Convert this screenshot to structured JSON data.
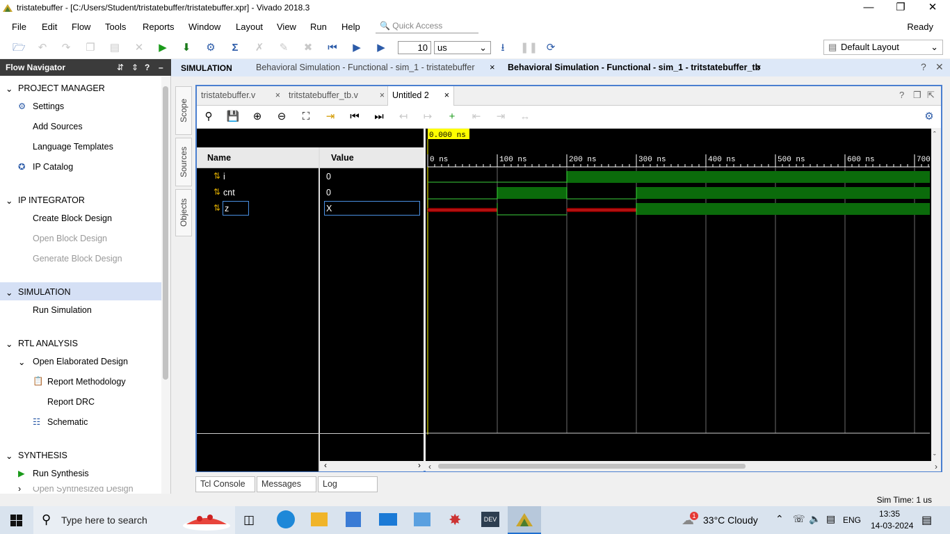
{
  "window": {
    "title": "tristatebuffer - [C:/Users/Student/tristatebuffer/tristatebuffer.xpr] - Vivado 2018.3"
  },
  "menu": [
    "File",
    "Edit",
    "Flow",
    "Tools",
    "Reports",
    "Window",
    "Layout",
    "View",
    "Run",
    "Help"
  ],
  "quick_access": "Quick Access",
  "status": "Ready",
  "toolbar": {
    "time_value": "10",
    "time_unit": "us",
    "layout": "Default Layout"
  },
  "flow_nav": {
    "title": "Flow Navigator",
    "project_manager": "PROJECT MANAGER",
    "settings": "Settings",
    "add_sources": "Add Sources",
    "language_templates": "Language Templates",
    "ip_catalog": "IP Catalog",
    "ip_integrator": "IP INTEGRATOR",
    "create_block": "Create Block Design",
    "open_block": "Open Block Design",
    "generate_block": "Generate Block Design",
    "simulation": "SIMULATION",
    "run_sim": "Run Simulation",
    "rtl": "RTL ANALYSIS",
    "open_elab": "Open Elaborated Design",
    "report_meth": "Report Methodology",
    "report_drc": "Report DRC",
    "schematic": "Schematic",
    "synthesis": "SYNTHESIS",
    "run_synth": "Run Synthesis",
    "open_synth": "Open Synthesized Design"
  },
  "sim_header": {
    "label": "SIMULATION",
    "tab1": "Behavioral Simulation - Functional - sim_1 - tristatebuffer",
    "tab2": "Behavioral Simulation - Functional - sim_1 - tritstatebuffer_tb"
  },
  "side_tabs": [
    "Scope",
    "Sources",
    "Objects"
  ],
  "wave_tabs": [
    "tristatebuffer.v",
    "tritstatebuffer_tb.v",
    "Untitled 2"
  ],
  "wave": {
    "cursor": "0.000 ns",
    "name_header": "Name",
    "value_header": "Value",
    "signals": [
      {
        "name": "i",
        "value": "0"
      },
      {
        "name": "cnt",
        "value": "0"
      },
      {
        "name": "z",
        "value": "X"
      }
    ],
    "ticks": [
      "0 ns",
      "100 ns",
      "200 ns",
      "300 ns",
      "400 ns",
      "500 ns",
      "600 ns",
      "700"
    ]
  },
  "bottom_tabs": [
    "Tcl Console",
    "Messages",
    "Log"
  ],
  "sim_time": "Sim Time: 1 us",
  "taskbar": {
    "search": "Type here to search",
    "weather": "33°C  Cloudy",
    "lang": "ENG",
    "time": "13:35",
    "date": "14-03-2024",
    "notif": "1"
  },
  "colors": {
    "wave_high": "#0b6b0b",
    "wave_line": "#3bd23b",
    "wave_x": "#8b0000",
    "cursor": "#ffff00",
    "accent": "#4a7fd0"
  }
}
